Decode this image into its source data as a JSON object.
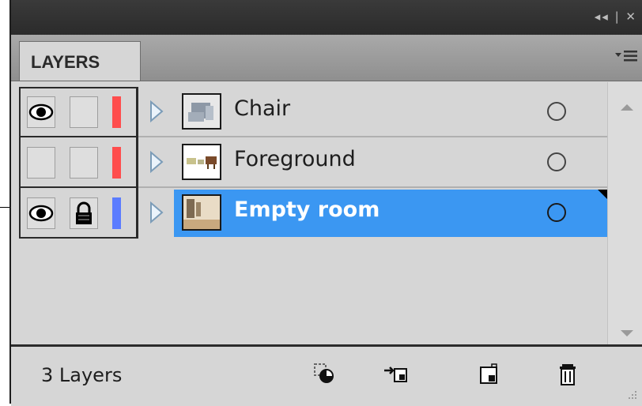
{
  "panel": {
    "tab_label": "LAYERS",
    "title_controls": "◂◂ | ✕"
  },
  "layers": [
    {
      "name": "Chair",
      "visible": true,
      "locked": false,
      "color": "#ff4d4d",
      "selected": false,
      "thumb": "chair"
    },
    {
      "name": "Foreground",
      "visible": false,
      "locked": false,
      "color": "#ff4d4d",
      "selected": false,
      "thumb": "foreground"
    },
    {
      "name": "Empty room",
      "visible": true,
      "locked": true,
      "color": "#5b7cff",
      "selected": true,
      "thumb": "room"
    }
  ],
  "footer": {
    "layer_count": "3 Layers",
    "buttons": [
      {
        "name": "make-clipping-mask-icon"
      },
      {
        "name": "create-sublayer-icon"
      },
      {
        "name": "create-new-layer-icon"
      },
      {
        "name": "delete-layer-icon"
      }
    ]
  },
  "colors": {
    "selection": "#3b97f2",
    "layer_red": "#ff4d4d",
    "layer_blue": "#5b7cff"
  }
}
